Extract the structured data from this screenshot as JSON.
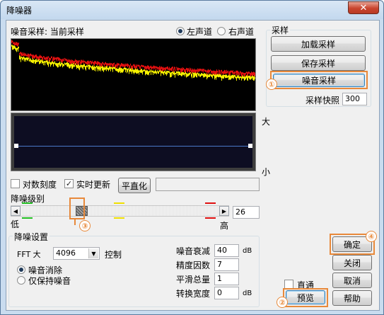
{
  "window": {
    "title": "降噪器",
    "close_glyph": "✕"
  },
  "spectrum": {
    "header": "噪音采样: 当前采样",
    "left_channel": "左声道",
    "right_channel": "右声道",
    "selected_channel": "left",
    "colors": {
      "background": "#000000",
      "noise_red": "#e01010",
      "noise_yellow": "#f5f000"
    }
  },
  "curve": {
    "label_high": "大",
    "label_low": "小",
    "line_color": "#4a78c8",
    "background": "#0d0d22"
  },
  "sampling": {
    "group_title": "采样",
    "load_label": "加载采样",
    "save_label": "保存采样",
    "noise_sample_label": "噪音采样",
    "snapshot_label": "采样快照",
    "snapshot_value": "300"
  },
  "options": {
    "log_scale_label": "对数刻度",
    "log_scale_checked": false,
    "realtime_label": "实时更新",
    "realtime_checked": true,
    "flatten_label": "平直化"
  },
  "noise_level": {
    "label": "降噪级别",
    "low": "低",
    "high": "高",
    "value": "26",
    "marker_colors": [
      "#22c022",
      "#f0e000",
      "#e01010"
    ]
  },
  "settings": {
    "group_title": "降噪设置",
    "fft_label": "FFT 大",
    "fft_value": "4096",
    "control_label": "控制",
    "mode_remove": "噪音消除",
    "mode_keep": "仅保持噪音",
    "selected_mode": "remove",
    "attenuation_label": "噪音衰减",
    "attenuation_value": "40",
    "attenuation_unit": "dB",
    "precision_label": "精度因数",
    "precision_value": "7",
    "smoothing_label": "平滑总量",
    "smoothing_value": "1",
    "transition_label": "转换宽度",
    "transition_value": "0",
    "transition_unit": "dB"
  },
  "actions": {
    "ok_label": "确定",
    "close_label": "关闭",
    "cancel_label": "取消",
    "help_label": "帮助",
    "bypass_label": "直通",
    "bypass_checked": false,
    "preview_label": "预览"
  },
  "annotations": {
    "n1": "①",
    "n2": "②",
    "n3": "③",
    "n4": "④",
    "color": "#e8893a"
  }
}
